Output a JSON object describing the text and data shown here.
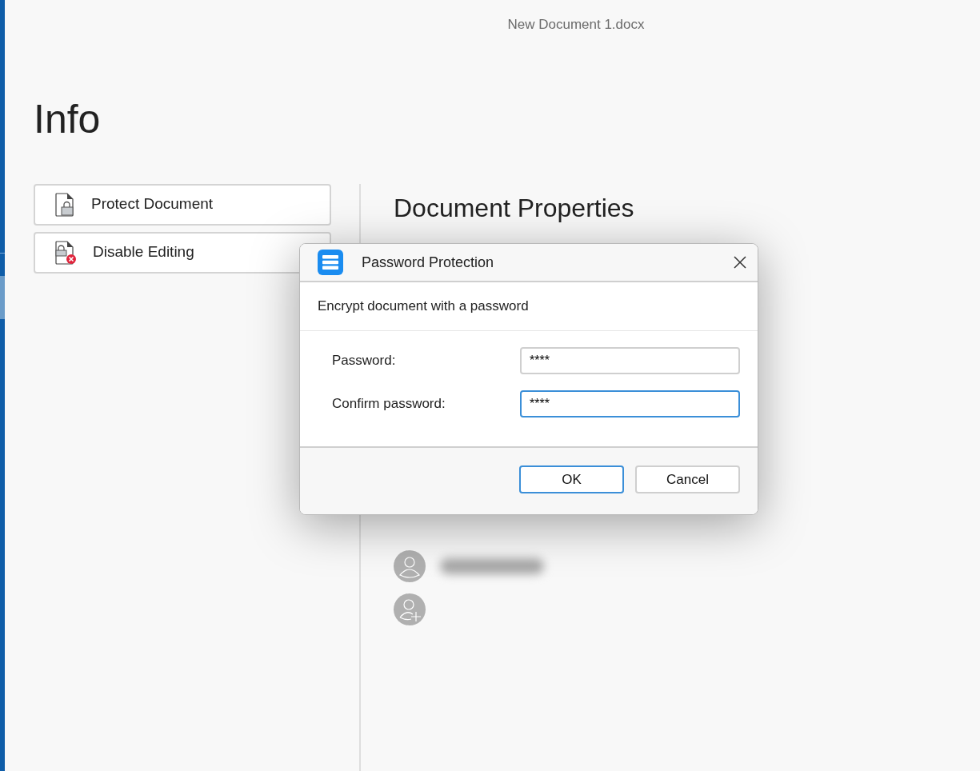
{
  "window": {
    "title": "New Document 1.docx"
  },
  "page": {
    "heading": "Info",
    "actions": [
      {
        "label": "Protect Document",
        "kind": "protect"
      },
      {
        "label": "Disable Editing",
        "kind": "disable"
      }
    ],
    "properties": {
      "heading": "Document Properties",
      "authors": [
        {
          "kind": "person"
        },
        {
          "kind": "add"
        }
      ]
    }
  },
  "dialog": {
    "title": "Password Protection",
    "subtitle": "Encrypt document with a password",
    "fields": [
      {
        "label": "Password:",
        "value": "****",
        "focused": false
      },
      {
        "label": "Confirm password:",
        "value": "****",
        "focused": true
      }
    ],
    "buttons": [
      {
        "label": "OK",
        "default": true
      },
      {
        "label": "Cancel",
        "default": false
      }
    ]
  }
}
